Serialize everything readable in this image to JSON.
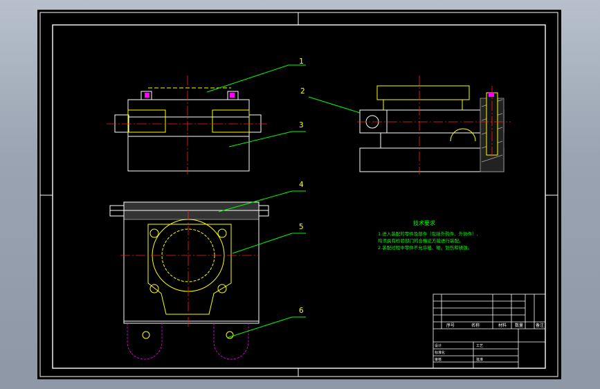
{
  "colors": {
    "background": "#000000",
    "outline": "#ffffff",
    "yellow": "#ffff00",
    "centerline": "#ff2020",
    "leader": "#00ff00",
    "magenta": "#ff00ff",
    "hatch": "#a8a8a8",
    "cyan": "#00ffff"
  },
  "balloons": [
    "1",
    "2",
    "3",
    "4",
    "5",
    "6"
  ],
  "notes": {
    "title": "技术要求",
    "lines": [
      "1.进入装配的零件及部件（包括外购件、外协件）,",
      "  均须具有检验部门的合格证方能进行装配。",
      "2.装配过程中零件不允许磕、碰、划伤和锈蚀。"
    ]
  },
  "title_block": {
    "header": {
      "seq": "序号",
      "name": "名称",
      "material": "材料",
      "qty": "数量",
      "remark": "备注"
    },
    "signoffs": [
      "设计",
      "标准化",
      "审核",
      "工艺",
      "批准"
    ]
  }
}
